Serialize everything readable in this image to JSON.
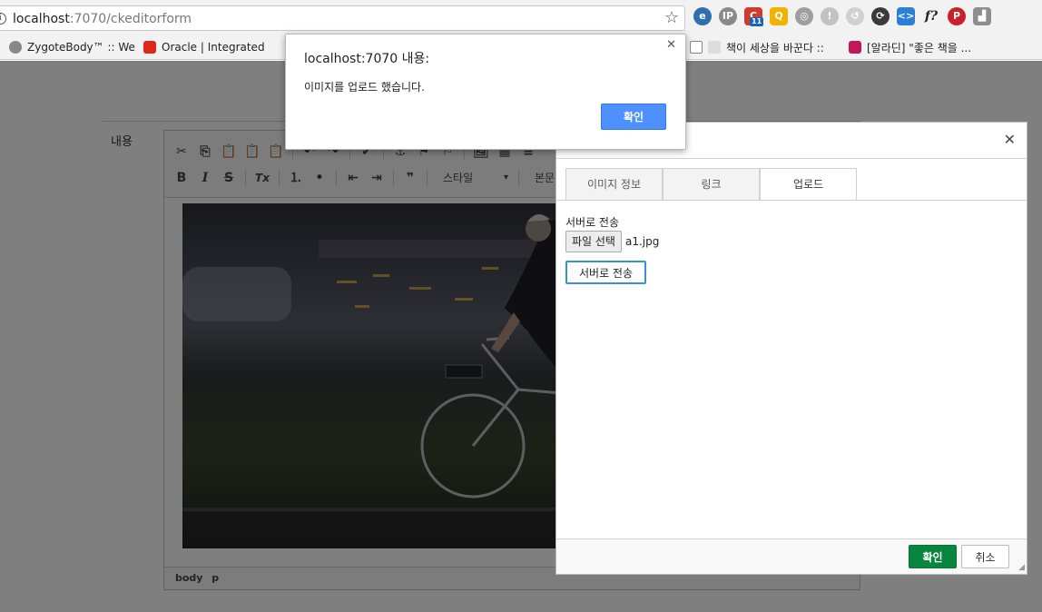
{
  "browser": {
    "url_host": "localhost",
    "url_path": ":7070/ckeditorform",
    "extension_badge": "11",
    "bookmarks": [
      {
        "label": "ZygoteBody™ :: Welc"
      },
      {
        "label": "Oracle | Integrated C"
      },
      {
        "label": "책이 세상을 바꾼다 ::"
      },
      {
        "label": "[알라딘] \"좋은 책을 ..."
      }
    ],
    "colors": {
      "accent": "#4d90fe"
    }
  },
  "page": {
    "field_label": "내용"
  },
  "editor": {
    "toolbar_row1": [
      "✂",
      "⎘",
      "📋",
      "📋",
      "📋",
      "↶",
      "↷",
      "✔",
      "⚓",
      "⚑",
      "⚐",
      "🖼",
      "▦",
      "≡"
    ],
    "toolbar_row2": [
      "B",
      "I",
      "S",
      "Tx",
      "⒈",
      "•",
      "⇤",
      "⇥",
      "❞"
    ],
    "styles_combo": "스타일",
    "format_combo": "본문",
    "status_path": "body p"
  },
  "image_dialog": {
    "tabs": [
      "이미지 정보",
      "링크",
      "업로드"
    ],
    "active_tab": "업로드",
    "upload_label": "서버로 전송",
    "file_button": "파일 선택",
    "file_name": "a1.jpg",
    "send_button": "서버로 전송",
    "ok_button": "확인",
    "cancel_button": "취소",
    "close_glyph": "✕"
  },
  "alert": {
    "title": "localhost:7070 내용:",
    "message": "이미지를 업로드 했습니다.",
    "ok_button": "확인",
    "close_glyph": "✕"
  }
}
